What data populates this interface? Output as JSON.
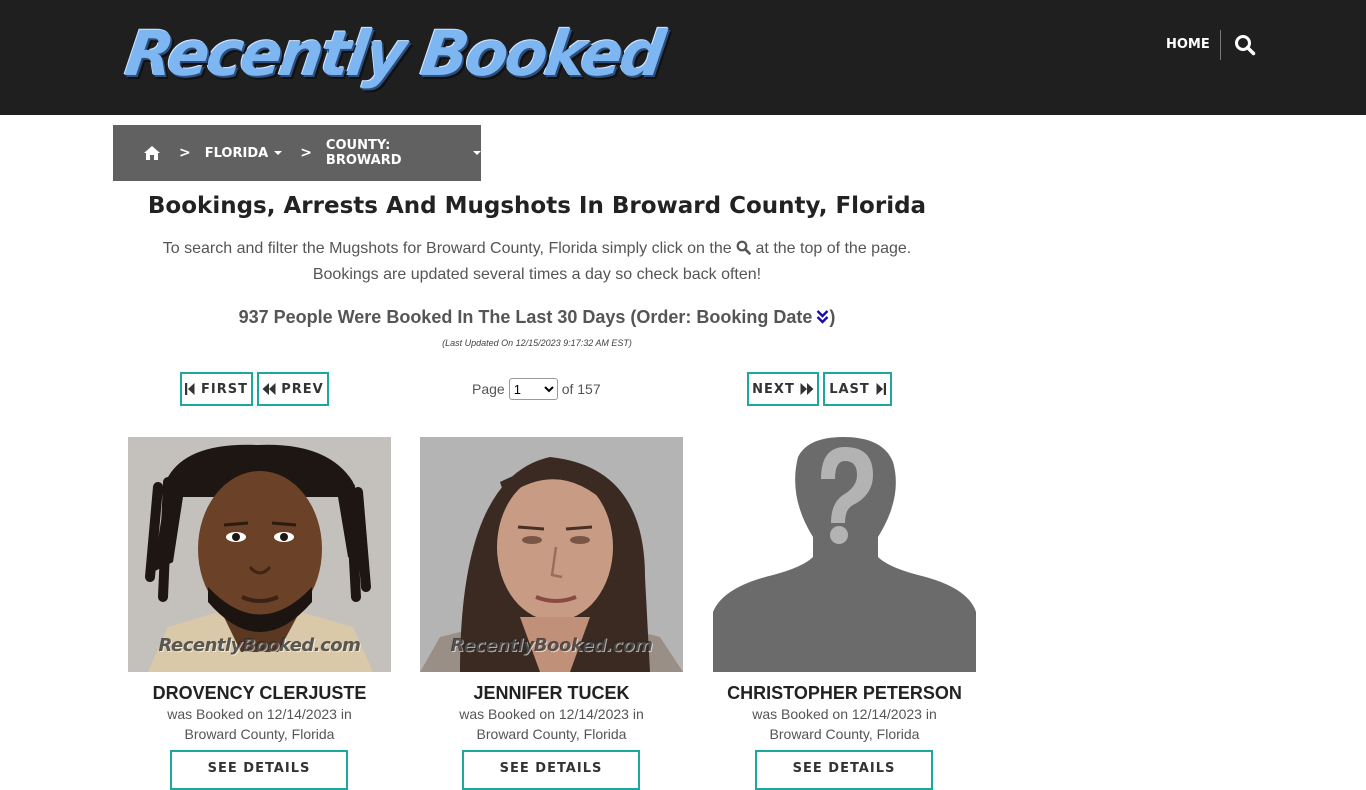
{
  "site": {
    "logo_text": "Recently Booked",
    "nav_home": "HOME"
  },
  "breadcrumb": {
    "state": "FLORIDA",
    "county": "COUNTY: BROWARD",
    "separator": ">"
  },
  "content": {
    "title": "Bookings, Arrests And Mugshots In Broward County, Florida",
    "intro_before_icon": "To search and filter the Mugshots for Broward County, Florida simply click on the",
    "intro_after_icon": "at the top of the page.",
    "intro_line2": "Bookings are updated several times a day so check back often!",
    "count_text": "937 People Were Booked In The Last 30 Days (Order: Booking Date",
    "count_close": ")",
    "updated": "(Last Updated On 12/15/2023 9:17:32 AM EST)"
  },
  "pager": {
    "first": "FIRST",
    "prev": "PREV",
    "next": "NEXT",
    "last": "LAST",
    "page_label": "Page",
    "current_page": "1",
    "of_label": "of 157"
  },
  "cards": [
    {
      "name": "DROVENCY CLERJUSTE",
      "booked": "was Booked on 12/14/2023 in",
      "location": "Broward County, Florida",
      "button": "SEE DETAILS",
      "watermark": "RecentlyBooked.com"
    },
    {
      "name": "JENNIFER TUCEK",
      "booked": "was Booked on 12/14/2023 in",
      "location": "Broward County, Florida",
      "button": "SEE DETAILS",
      "watermark": "RecentlyBooked.com"
    },
    {
      "name": "CHRISTOPHER PETERSON",
      "booked": "was Booked on 12/14/2023 in",
      "location": "Broward County, Florida",
      "button": "SEE DETAILS"
    }
  ],
  "colors": {
    "header_bg": "#1f1f1f",
    "breadcrumb_bg": "#616161",
    "accent_teal": "#1fa79f",
    "sort_icon": "#1a0dab"
  },
  "icons": [
    "search-icon",
    "home-icon",
    "chevron-right-icon",
    "caret-down-icon",
    "step-backward-icon",
    "backward-icon",
    "forward-icon",
    "step-forward-icon",
    "double-chevron-down-icon"
  ]
}
